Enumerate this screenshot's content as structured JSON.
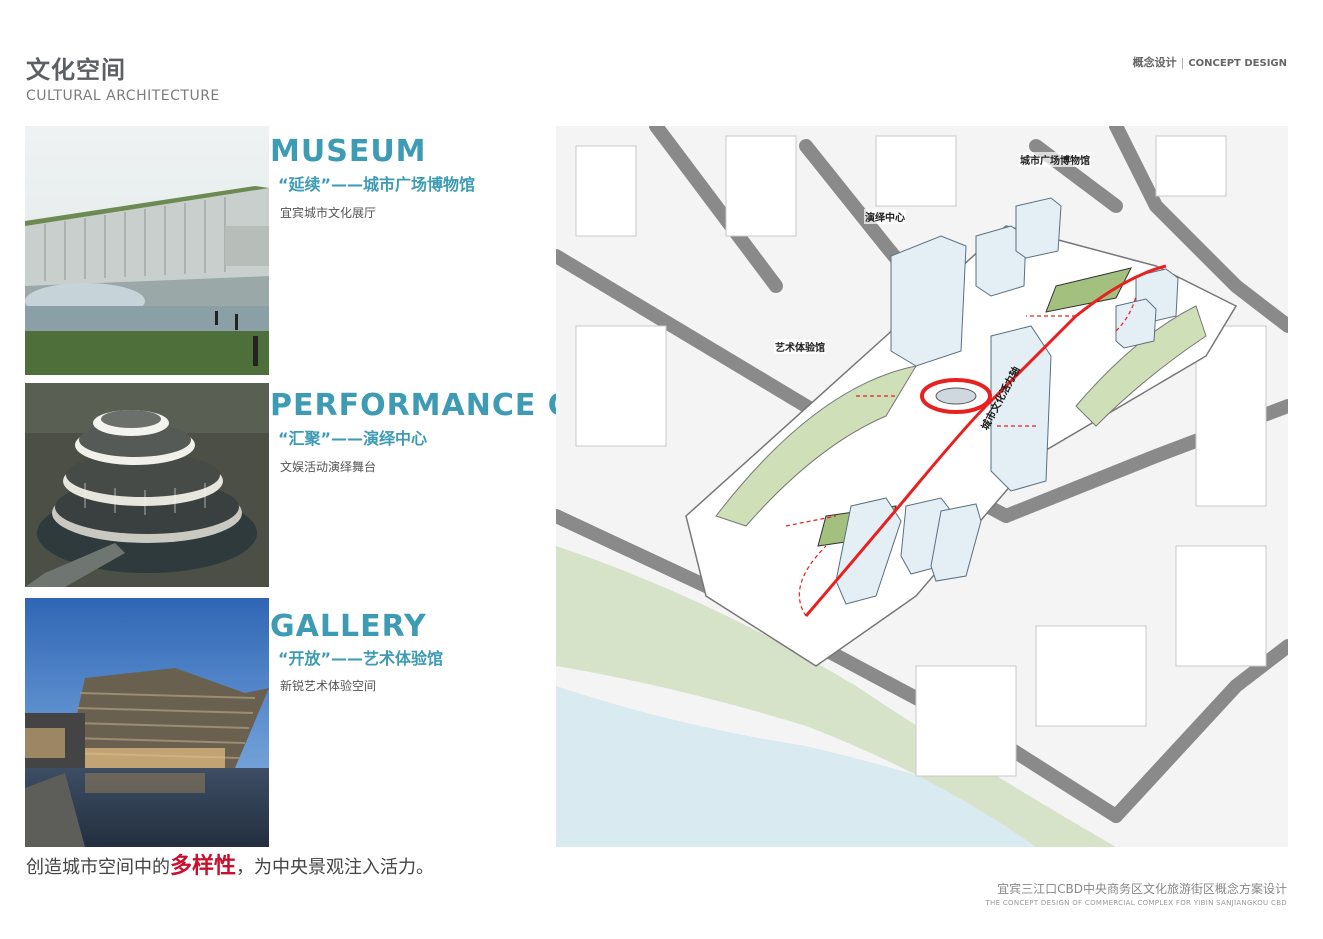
{
  "header": {
    "title_cn": "文化空间",
    "title_en": "CULTURAL ARCHITECTURE",
    "concept_cn": "概念设计",
    "concept_sep": "|",
    "concept_en": "CONCEPT DESIGN"
  },
  "sections": [
    {
      "title_en": "MUSEUM",
      "title_cn": "“延续”——城市广场博物馆",
      "desc": "宜宾城市文化展厅"
    },
    {
      "title_en": "PERFORMANCE  CENTER",
      "title_cn": "“汇聚”——演绎中心",
      "desc": "文娱活动演绎舞台"
    },
    {
      "title_en": "GALLERY",
      "title_cn": "“开放”——艺术体验馆",
      "desc": "新锐艺术体验空间"
    }
  ],
  "map": {
    "labels": {
      "museum": "城市广场博物馆",
      "performance": "演绎中心",
      "gallery": "艺术体验馆",
      "axis": "城市文化活力轴"
    },
    "colors": {
      "route": "#e8201f",
      "green": "#cfe0b8",
      "water": "#d7e9f0",
      "road": "#8a8a8a"
    }
  },
  "bottom": {
    "tagline_pre": "创造城市空间中的",
    "tagline_highlight": "多样性",
    "tagline_post": "，为中央景观注入活力。"
  },
  "footer": {
    "cn": "宜宾三江口CBD中央商务区文化旅游街区概念方案设计",
    "en": "THE CONCEPT DESIGN OF COMMERCIAL COMPLEX  FOR YIBIN SANJIANGKOU CBD"
  }
}
